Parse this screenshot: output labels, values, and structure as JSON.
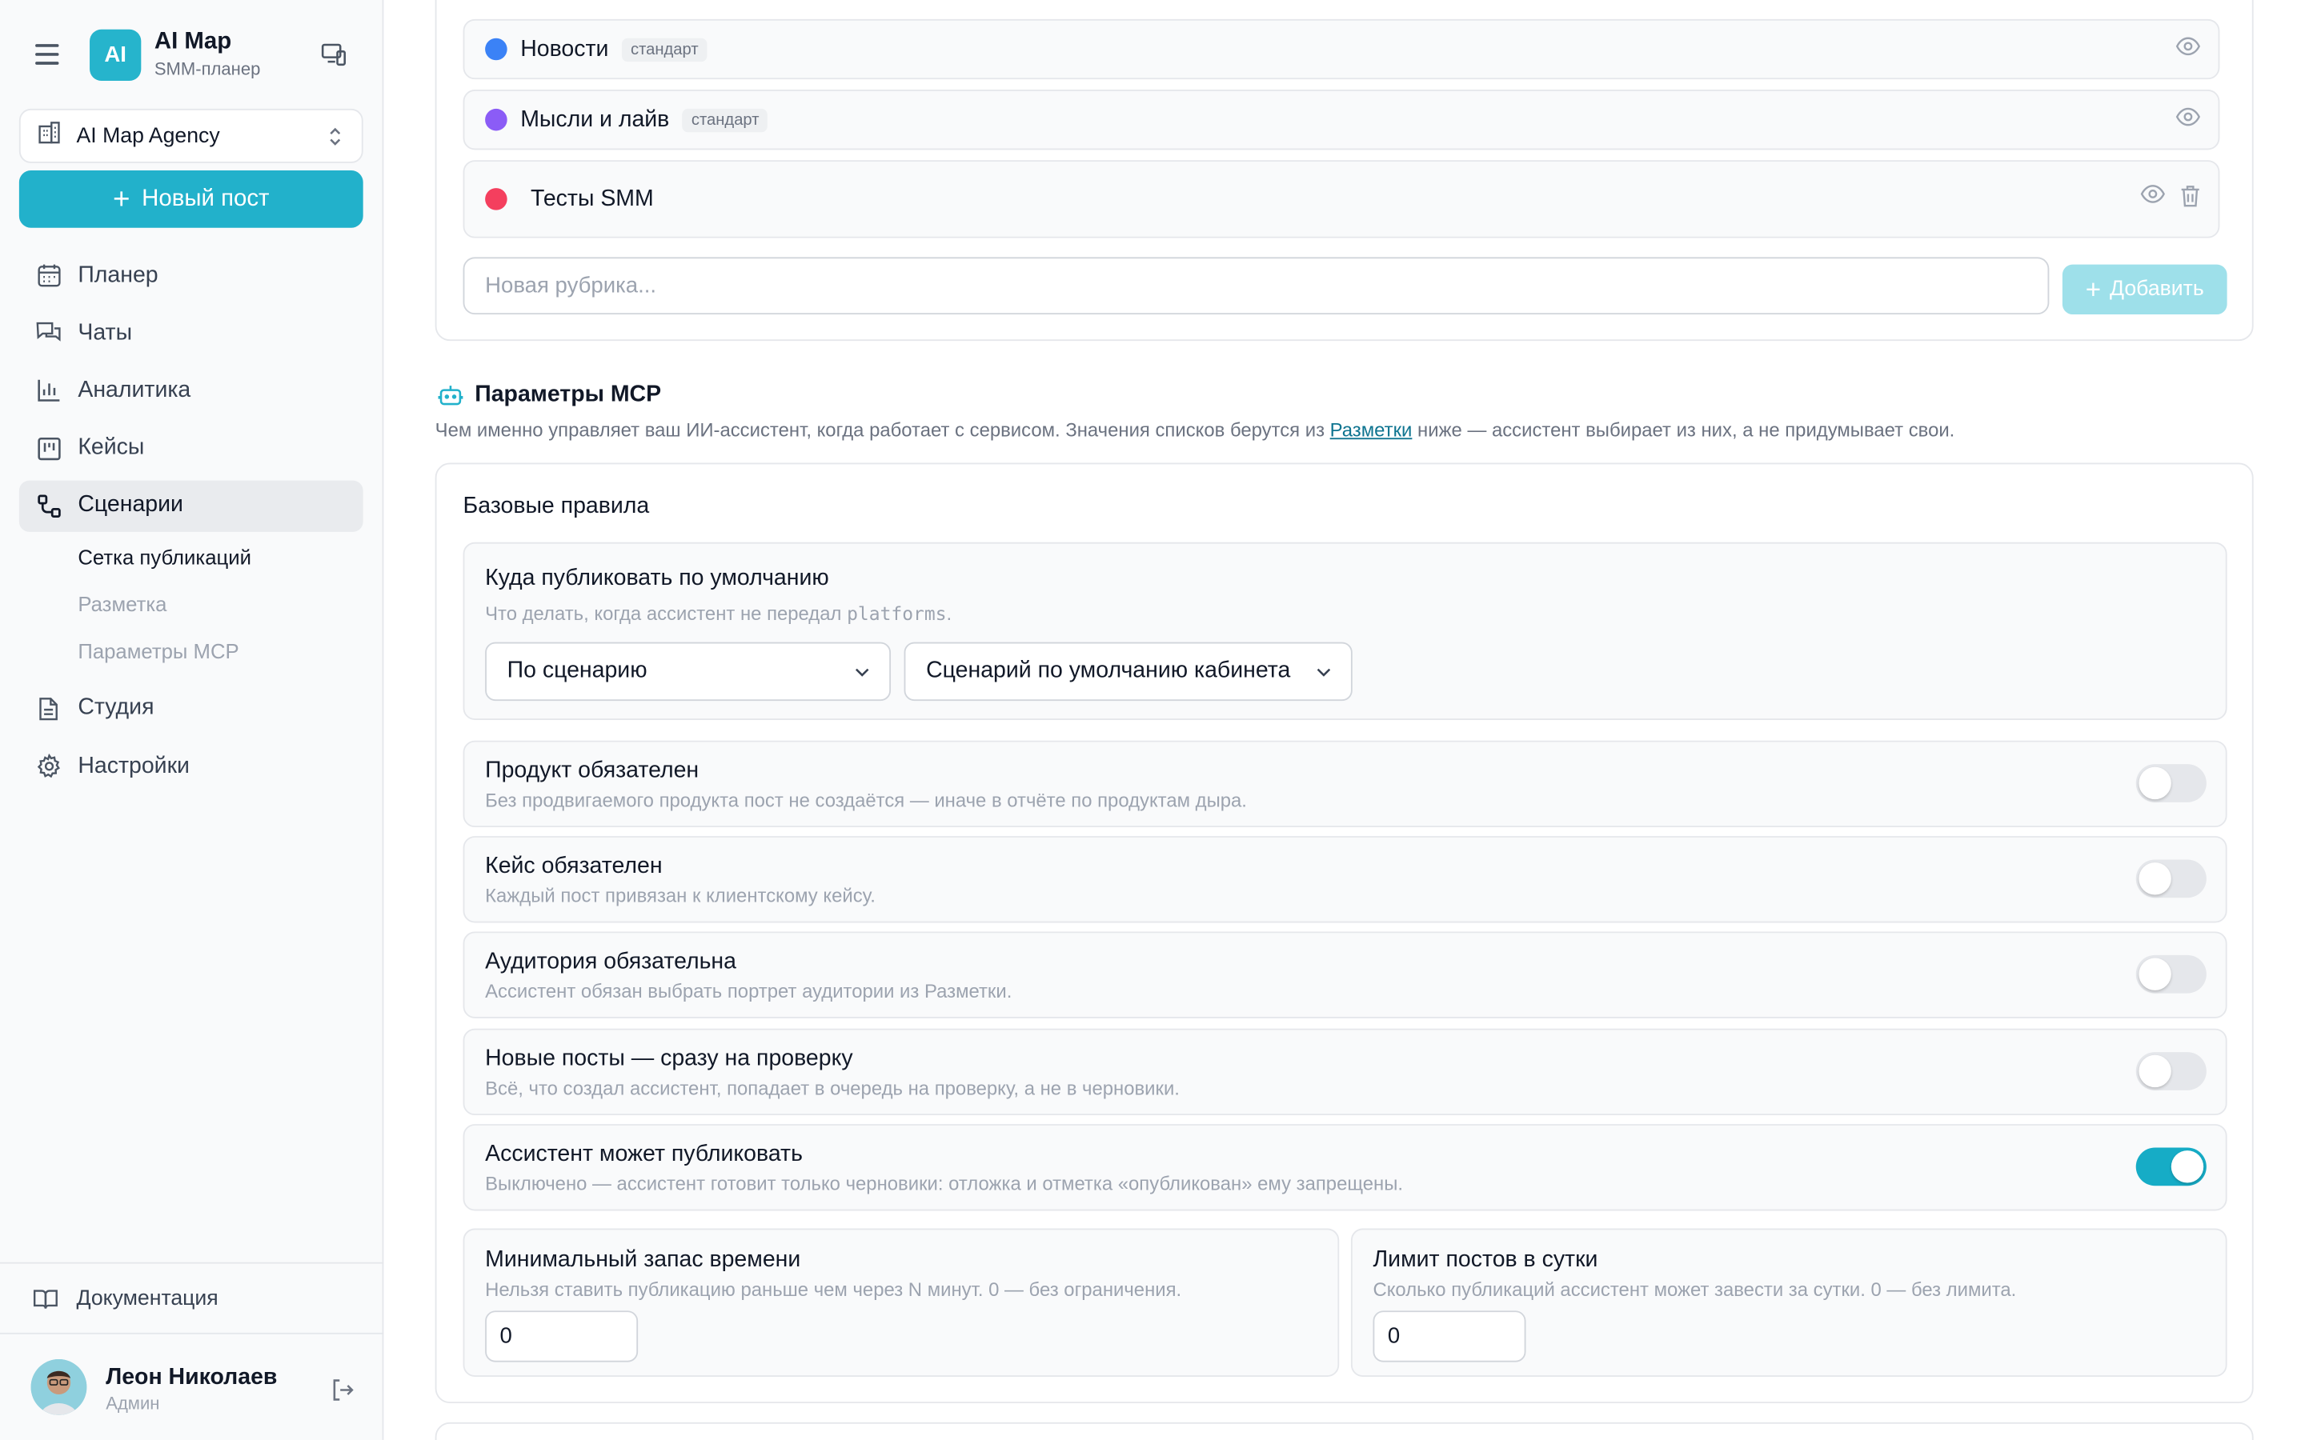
{
  "app": {
    "logo_text": "AI",
    "name": "AI Map",
    "subtitle": "SMM-планер"
  },
  "org": {
    "name": "AI Map Agency"
  },
  "new_post_label": "Новый пост",
  "nav": {
    "items": [
      {
        "label": "Планер",
        "icon": "calendar-icon"
      },
      {
        "label": "Чаты",
        "icon": "chat-icon"
      },
      {
        "label": "Аналитика",
        "icon": "bar-chart-icon"
      },
      {
        "label": "Кейсы",
        "icon": "kanban-icon"
      },
      {
        "label": "Сценарии",
        "icon": "workflow-icon",
        "active": true
      },
      {
        "label": "Студия",
        "icon": "document-icon"
      },
      {
        "label": "Настройки",
        "icon": "gear-icon"
      }
    ],
    "sub": [
      "Сетка публикаций",
      "Разметка",
      "Параметры MCP"
    ]
  },
  "docs_label": "Документация",
  "user": {
    "name": "Леон Николаев",
    "role": "Админ"
  },
  "rubrics": [
    {
      "name": "Новости",
      "tag": "стандарт",
      "color": "#3b82f6"
    },
    {
      "name": "Мысли и лайв",
      "tag": "стандарт",
      "color": "#8b5cf6"
    },
    {
      "name": "Тесты SMM",
      "tag": "",
      "color": "#f43f5e"
    }
  ],
  "new_rubric_placeholder": "Новая рубрика...",
  "add_label": "Добавить",
  "mcp": {
    "title": "Параметры MCP",
    "desc_before": "Чем именно управляет ваш ИИ-ассистент, когда работает с сервисом. Значения списков берутся из ",
    "desc_link": "Разметки",
    "desc_after": " ниже — ассистент выбирает из них, а не придумывает свои."
  },
  "base_rules": {
    "title": "Базовые правила",
    "publish_default": {
      "title": "Куда публиковать по умолчанию",
      "desc_before": "Что делать, когда ассистент не передал ",
      "desc_code": "platforms",
      "desc_after": ".",
      "select1": "По сценарию",
      "select2": "Сценарий по умолчанию кабинета"
    },
    "toggles": [
      {
        "title": "Продукт обязателен",
        "desc": "Без продвигаемого продукта пост не создаётся — иначе в отчёте по продуктам дыра.",
        "on": false
      },
      {
        "title": "Кейс обязателен",
        "desc": "Каждый пост привязан к клиентскому кейсу.",
        "on": false
      },
      {
        "title": "Аудитория обязательна",
        "desc": "Ассистент обязан выбрать портрет аудитории из Разметки.",
        "on": false
      },
      {
        "title": "Новые посты — сразу на проверку",
        "desc": "Всё, что создал ассистент, попадает в очередь на проверку, а не в черновики.",
        "on": false
      },
      {
        "title": "Ассистент может публиковать",
        "desc": "Выключено — ассистент готовит только черновики: отложка и отметка «опубликован» ему запрещены.",
        "on": true
      }
    ],
    "min_time": {
      "title": "Минимальный запас времени",
      "desc": "Нельзя ставить публикацию раньше чем через N минут. 0 — без ограничения.",
      "value": "0"
    },
    "daily_limit": {
      "title": "Лимит постов в сутки",
      "desc": "Сколько публикаций ассистент может завести за сутки. 0 — без лимита.",
      "value": "0"
    }
  },
  "colors": {
    "accent": "#22b1cb",
    "toggle_on": "#16acc6"
  }
}
